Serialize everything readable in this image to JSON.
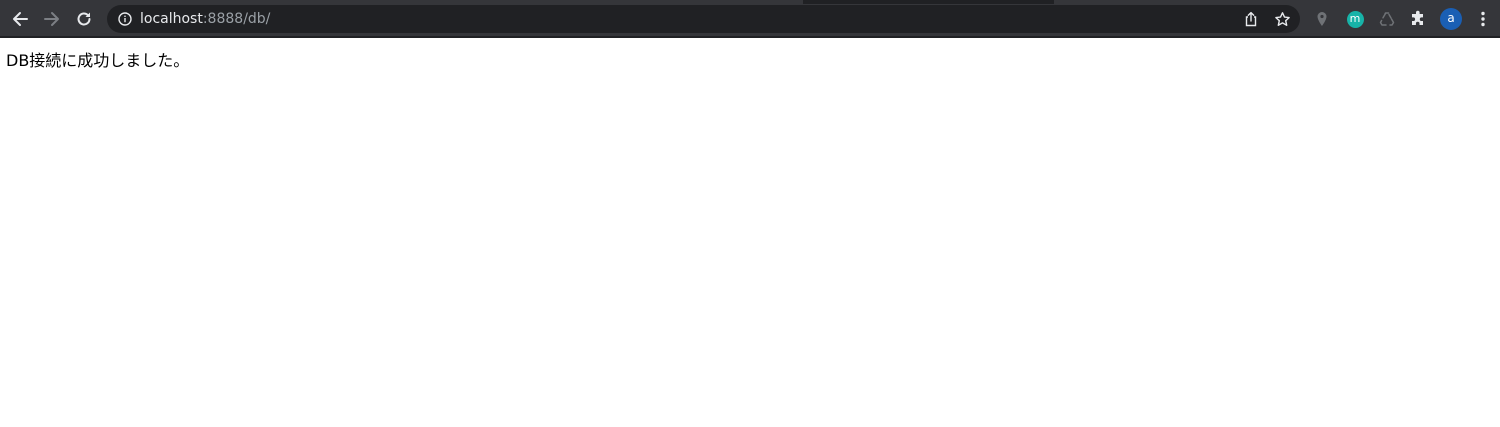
{
  "browser": {
    "url_host": "localhost",
    "url_rest": ":8888/db/",
    "profile_initial": "a",
    "extension_m_label": "m",
    "accent_colors": {
      "toolbar": "#35363a",
      "omnibox": "#202124",
      "extension_m": "#17b3a8",
      "avatar": "#1a5fb4"
    },
    "icons": {
      "back": "arrow-left-icon",
      "forward": "arrow-right-icon",
      "reload": "reload-icon",
      "site_info": "info-icon",
      "share": "share-icon",
      "bookmark": "star-icon",
      "ext_location": "location-pin-icon",
      "ext_recycle": "recycle-icon",
      "extensions": "puzzle-icon",
      "menu": "kebab-menu-icon"
    }
  },
  "page": {
    "message": "DB接続に成功しました。"
  }
}
